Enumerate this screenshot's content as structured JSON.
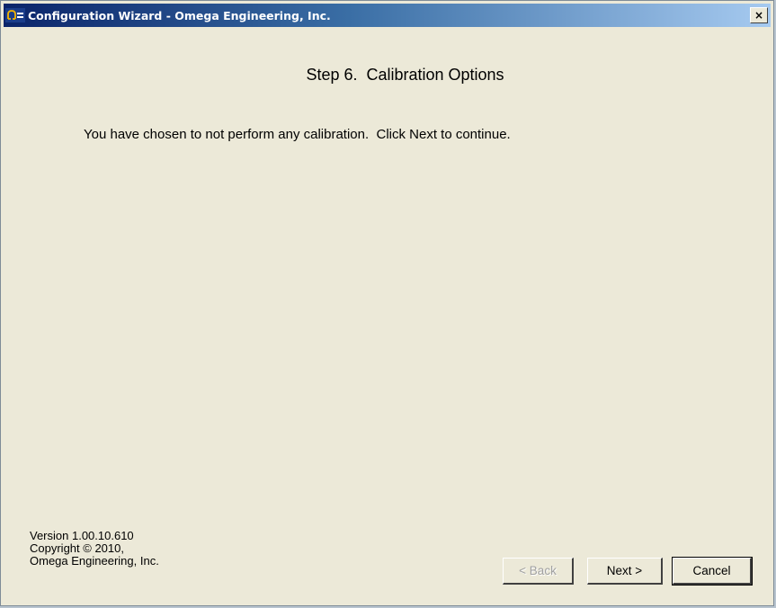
{
  "window": {
    "title": "Configuration Wizard - Omega Engineering, Inc.",
    "close_label": "×"
  },
  "step": {
    "title": "Step 6.  Calibration Options"
  },
  "message": "You have chosen to not perform any calibration.  Click Next to continue.",
  "footer": {
    "version": "Version 1.00.10.610",
    "copyright": "Copyright © 2010,",
    "company": "Omega Engineering, Inc."
  },
  "buttons": {
    "back": "< Back",
    "next": "Next >",
    "cancel": "Cancel"
  },
  "colors": {
    "titlebar_start": "#0a246a",
    "titlebar_end": "#a6caf0",
    "dialog_bg": "#ece9d8"
  },
  "icons": {
    "app": "omega-logo-icon",
    "close": "close-icon"
  }
}
